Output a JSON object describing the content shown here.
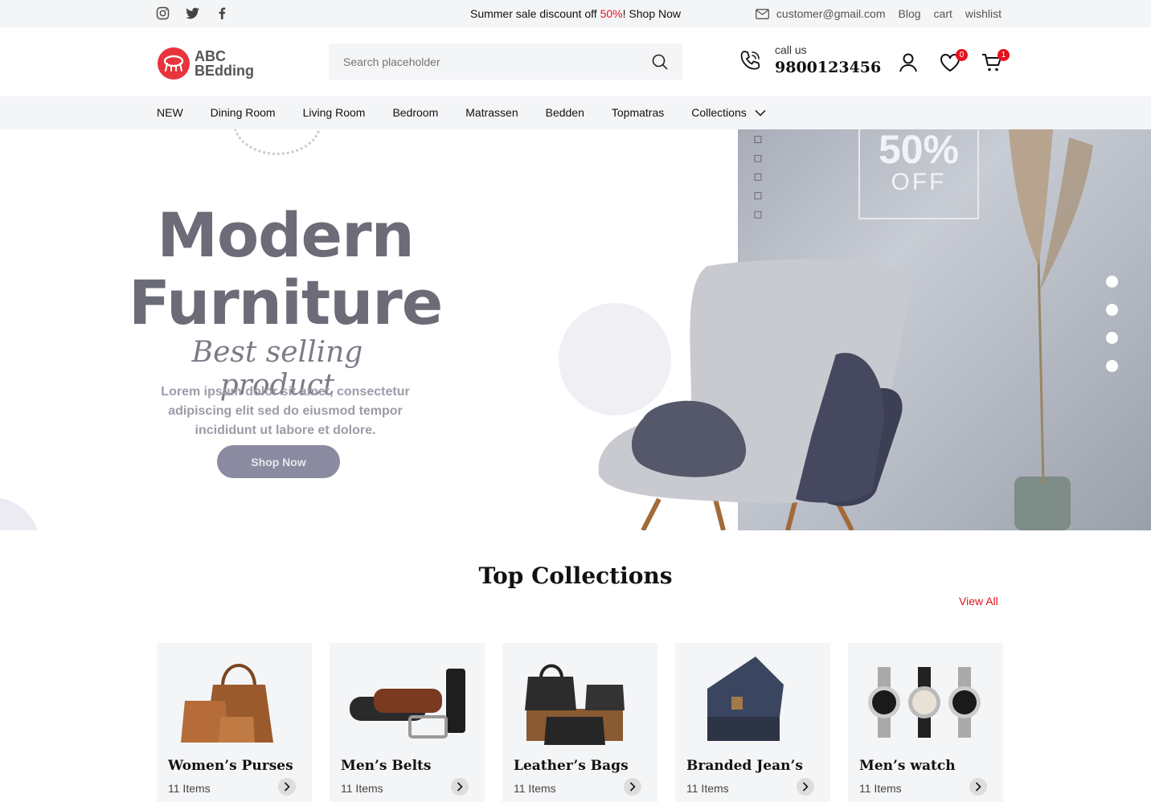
{
  "topbar": {
    "social_icons": [
      "instagram-icon",
      "twitter-icon",
      "facebook-icon"
    ],
    "promo_prefix": "Summer sale discount off ",
    "promo_highlight": "50%",
    "promo_suffix": "! Shop Now",
    "email": "customer@gmail.com",
    "links": [
      "Blog",
      "cart",
      "wishlist"
    ]
  },
  "header": {
    "logo_line1": "ABC",
    "logo_line2": "BEdding",
    "search_placeholder": "Search placeholder",
    "call_label": "call us",
    "phone": "9800123456",
    "wishlist_count": "0",
    "cart_count": "1"
  },
  "nav": {
    "items": [
      "NEW",
      "Dining Room",
      "Living Room",
      "Bedroom",
      "Matrassen",
      "Bedden",
      "Topmatras",
      "Collections"
    ]
  },
  "hero": {
    "title_line1": "Modern",
    "title_line2": "Furniture",
    "script": "Best selling product",
    "description": "Lorem ipsum dolor sit amet, consectetur adipiscing elit sed do eiusmod tempor incididunt ut labore et dolore.",
    "cta": "Shop Now",
    "offer_percent": "50%",
    "offer_label": "OFF",
    "slide_count": 4
  },
  "collections": {
    "title": "Top Collections",
    "view_all": "View All",
    "items": [
      {
        "name": "Women’s Purses",
        "count": "11 Items"
      },
      {
        "name": "Men’s Belts",
        "count": "11 Items"
      },
      {
        "name": "Leather’s Bags",
        "count": "11 Items"
      },
      {
        "name": "Branded Jean’s",
        "count": "11 Items"
      },
      {
        "name": "Men’s watch",
        "count": "11 Items"
      }
    ]
  },
  "colors": {
    "accent": "#e4121f",
    "brand": "#e8343d",
    "surface": "#f4f5f7"
  }
}
